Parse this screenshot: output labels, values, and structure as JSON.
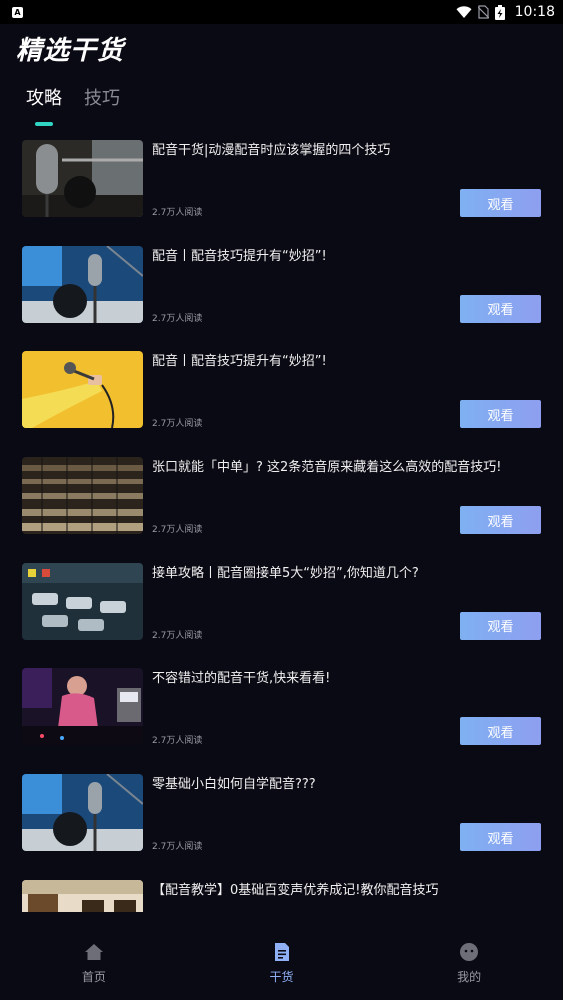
{
  "status_bar": {
    "app_icon_letter": "A",
    "time": "10:18"
  },
  "page": {
    "title": "精选干货"
  },
  "tabs": [
    {
      "label": "攻略",
      "active": true
    },
    {
      "label": "技巧",
      "active": false
    }
  ],
  "articles": [
    {
      "title": "配音干货|动漫配音时应该掌握的四个技巧",
      "reads": "2.7万人阅读",
      "button": "观看",
      "thumb_icon": "studio-microphone-icon"
    },
    {
      "title": "配音丨配音技巧提升有“妙招”!",
      "reads": "2.7万人阅读",
      "button": "观看",
      "thumb_icon": "blue-microphone-icon"
    },
    {
      "title": "配音丨配音技巧提升有“妙招”!",
      "reads": "2.7万人阅读",
      "button": "观看",
      "thumb_icon": "hand-microphone-icon"
    },
    {
      "title": "张口就能「中单」? 这2条范音原来藏着这么高效的配音技巧!",
      "reads": "2.7万人阅读",
      "button": "观看",
      "thumb_icon": "mixing-console-icon"
    },
    {
      "title": "接单攻略丨配音圈接单5大“妙招”,你知道几个?",
      "reads": "2.7万人阅读",
      "button": "观看",
      "thumb_icon": "audio-mixer-icon"
    },
    {
      "title": "不容错过的配音干货,快来看看!",
      "reads": "2.7万人阅读",
      "button": "观看",
      "thumb_icon": "dj-studio-icon"
    },
    {
      "title": "零基础小白如何自学配音???",
      "reads": "2.7万人阅读",
      "button": "观看",
      "thumb_icon": "blue-microphone-icon"
    },
    {
      "title": "【配音教学】0基础百变声优养成记!教你配音技巧",
      "reads": "",
      "button": "",
      "thumb_icon": "studio-room-icon"
    }
  ],
  "bottom_nav": [
    {
      "label": "首页",
      "icon": "home-icon",
      "active": false
    },
    {
      "label": "干货",
      "icon": "document-icon",
      "active": true
    },
    {
      "label": "我的",
      "icon": "profile-icon",
      "active": false
    }
  ],
  "colors": {
    "background": "#0a0a14",
    "tab_indicator": "#2fd4c2",
    "button_gradient_start": "#7fb0f2",
    "button_gradient_end": "#8e9ff0",
    "nav_active": "#8fb0f5"
  }
}
